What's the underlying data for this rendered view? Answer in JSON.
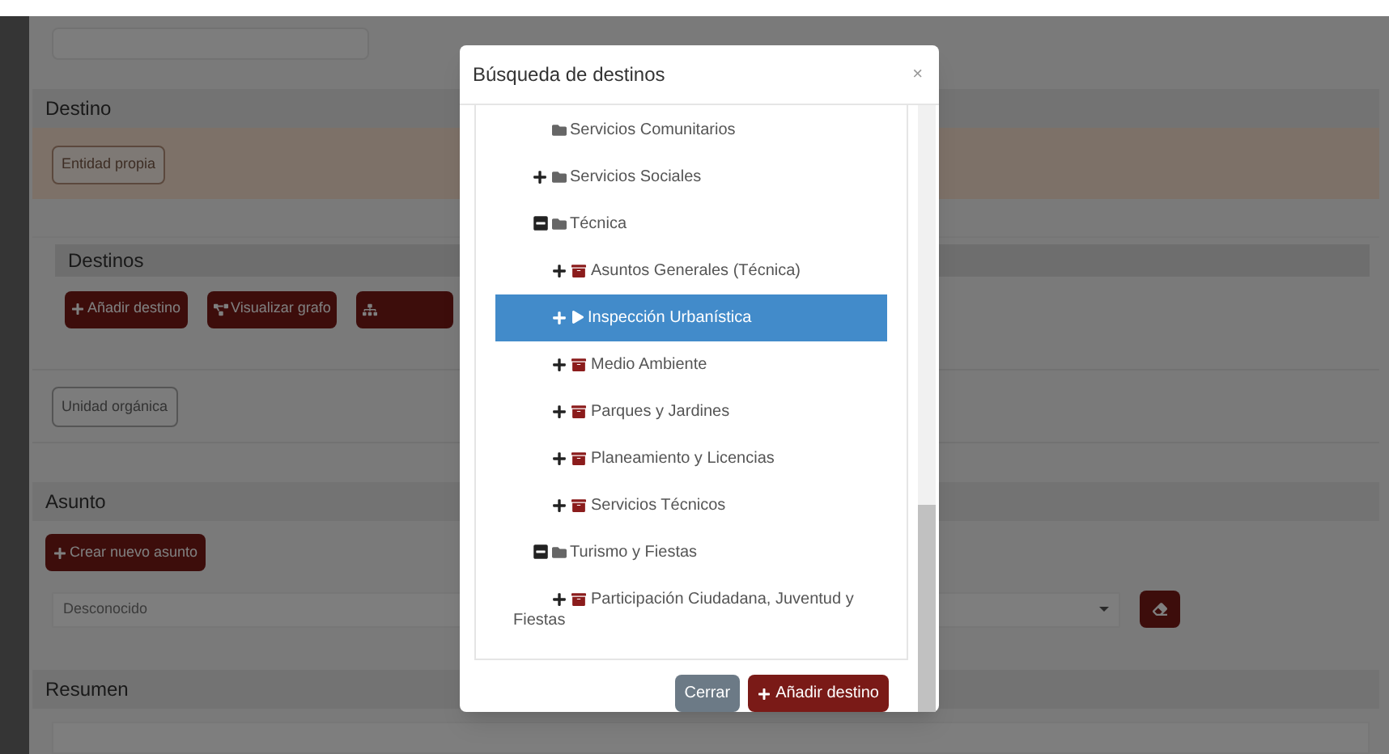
{
  "destino": {
    "header": "Destino",
    "entity_button": "Entidad propia"
  },
  "destinos": {
    "header": "Destinos",
    "buttons": [
      {
        "label": "Añadir destino",
        "kind": "add"
      },
      {
        "label": "Visualizar grafo",
        "kind": "graph"
      },
      {
        "kind": "tree"
      }
    ]
  },
  "unit_button": "Unidad orgánica",
  "asunto": {
    "header": "Asunto",
    "create_button": "Crear nuevo asunto",
    "select_value": "Desconocido"
  },
  "resumen": {
    "header": "Resumen"
  },
  "modal": {
    "title": "Búsqueda de destinos",
    "close": "×",
    "tree": [
      {
        "label": "Servicios Comunitarios",
        "kind": "folder",
        "selected": false
      },
      {
        "label": "Servicios Sociales",
        "kind": "folder",
        "expanded": false,
        "selected": false
      },
      {
        "label": "Técnica",
        "kind": "folder",
        "expanded": true,
        "selected": false,
        "children": [
          {
            "label": "Asuntos Generales (Técnica)",
            "kind": "unit",
            "expanded": false,
            "selected": false
          },
          {
            "label": "Inspección Urbanística",
            "kind": "current",
            "expanded": false,
            "selected": true
          },
          {
            "label": "Medio Ambiente",
            "kind": "unit",
            "expanded": false,
            "selected": false
          },
          {
            "label": "Parques y Jardines",
            "kind": "unit",
            "expanded": false,
            "selected": false
          },
          {
            "label": "Planeamiento y Licencias",
            "kind": "unit",
            "expanded": false,
            "selected": false
          },
          {
            "label": "Servicios Técnicos",
            "kind": "unit",
            "expanded": false,
            "selected": false
          }
        ]
      },
      {
        "label": "Turismo y Fiestas",
        "kind": "folder",
        "expanded": true,
        "selected": false,
        "children": [
          {
            "label": "Participación Ciudadana, Juventud y Fiestas",
            "kind": "unit",
            "expanded": false,
            "selected": false
          }
        ]
      }
    ],
    "buttons": [
      {
        "label": "Cerrar",
        "kind": "secondary"
      },
      {
        "label": "Añadir destino",
        "kind": "primary"
      }
    ]
  }
}
